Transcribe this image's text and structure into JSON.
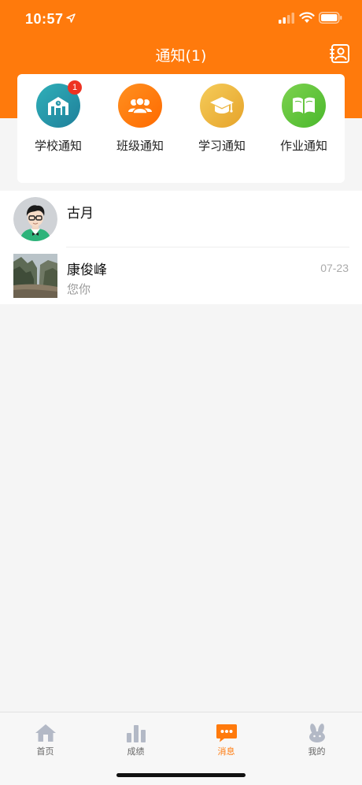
{
  "status_bar": {
    "time": "10:57"
  },
  "header": {
    "title": "通知(1)",
    "contacts_icon": "contacts-icon"
  },
  "categories": [
    {
      "label": "学校通知",
      "icon": "school-icon",
      "color": "#2a97a7",
      "badge": "1"
    },
    {
      "label": "班级通知",
      "icon": "group-icon",
      "color": "#ff7a0c"
    },
    {
      "label": "学习通知",
      "icon": "graduation-cap-icon",
      "color": "#efb63a"
    },
    {
      "label": "作业通知",
      "icon": "book-icon",
      "color": "#62c83b"
    }
  ],
  "messages": [
    {
      "name": "古月",
      "preview": "",
      "time": ""
    },
    {
      "name": "康俊峰",
      "preview": "您你",
      "time": "07-23"
    }
  ],
  "tabs": [
    {
      "label": "首页",
      "icon": "home-icon",
      "active": false
    },
    {
      "label": "成绩",
      "icon": "bar-chart-icon",
      "active": false
    },
    {
      "label": "消息",
      "icon": "message-icon",
      "active": true
    },
    {
      "label": "我的",
      "icon": "rabbit-icon",
      "active": false
    }
  ],
  "colors": {
    "brand": "#ff7a0c",
    "badge": "#ee3322"
  }
}
